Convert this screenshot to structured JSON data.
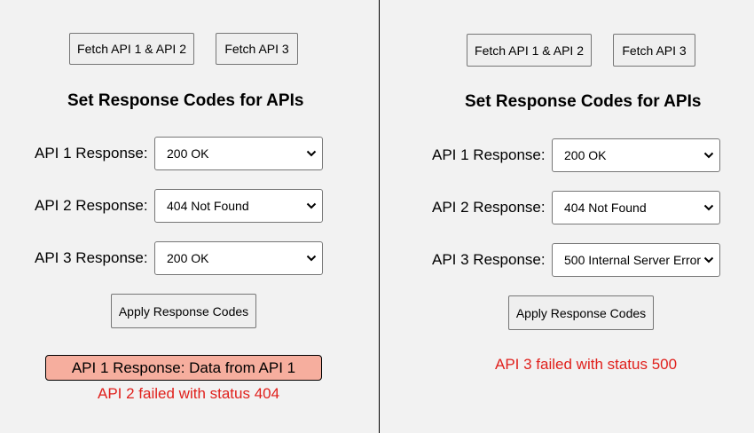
{
  "panels": [
    {
      "fetch12_label": "Fetch API 1 & API 2",
      "fetch3_label": "Fetch API 3",
      "heading": "Set Response Codes for APIs",
      "rows": [
        {
          "label": "API 1 Response:",
          "value": "200 OK"
        },
        {
          "label": "API 2 Response:",
          "value": "404 Not Found"
        },
        {
          "label": "API 3 Response:",
          "value": "200 OK"
        }
      ],
      "apply_label": "Apply Response Codes",
      "success_message": "API 1 Response: Data from API 1",
      "error_message": "API 2 failed with status 404"
    },
    {
      "fetch12_label": "Fetch API 1 & API 2",
      "fetch3_label": "Fetch API 3",
      "heading": "Set Response Codes for APIs",
      "rows": [
        {
          "label": "API 1 Response:",
          "value": "200 OK"
        },
        {
          "label": "API 2 Response:",
          "value": "404 Not Found"
        },
        {
          "label": "API 3 Response:",
          "value": "500 Internal Server Error"
        }
      ],
      "apply_label": "Apply Response Codes",
      "error_message": "API 3 failed with status 500"
    }
  ],
  "colors": {
    "background": "#f2f2f2",
    "success_fill": "#f6ae9e",
    "error_text": "#e0201c"
  },
  "icons": {
    "select_arrow": "chevron-down-icon"
  }
}
